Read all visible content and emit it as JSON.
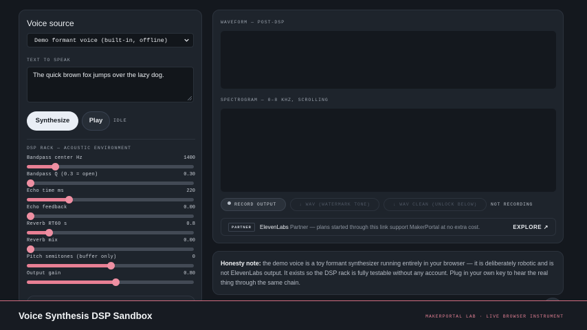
{
  "voice_source": {
    "title": "Voice source",
    "select_value": "Demo formant voice (built-in, offline)",
    "text_label": "TEXT TO SPEAK",
    "text_value": "The quick brown fox jumps over the lazy dog.",
    "synthesize_label": "Synthesize",
    "play_label": "Play",
    "status": "IDLE"
  },
  "dsp_rack": {
    "title": "DSP RACK — ACOUSTIC ENVIRONMENT",
    "sliders": [
      {
        "label": "Bandpass center Hz",
        "value": "1400",
        "fraction": 0.17
      },
      {
        "label": "Bandpass Q (0.3 = open)",
        "value": "0.30",
        "fraction": 0.02
      },
      {
        "label": "Echo time ms",
        "value": "220",
        "fraction": 0.25
      },
      {
        "label": "Echo feedback",
        "value": "0.00",
        "fraction": 0.02
      },
      {
        "label": "Reverb RT60 s",
        "value": "0.8",
        "fraction": 0.13
      },
      {
        "label": "Reverb mix",
        "value": "0.00",
        "fraction": 0.02
      },
      {
        "label": "Pitch semitones (buffer only)",
        "value": "0",
        "fraction": 0.5
      },
      {
        "label": "Output gain",
        "value": "0.80",
        "fraction": 0.53
      }
    ]
  },
  "visuals": {
    "waveform_label": "WAVEFORM — POST-DSP",
    "spectrogram_label": "SPECTROGRAM — 0–8 KHZ, SCROLLING"
  },
  "recording": {
    "record_label": "RECORD OUTPUT",
    "wav_watermark_label": "↓ WAV (WATERMARK TONE)",
    "wav_clean_label": "↓ WAV CLEAN (UNLOCK BELOW)",
    "status": "NOT RECORDING"
  },
  "partner": {
    "badge": "PARTNER",
    "brand": "ElevenLabs",
    "text": " Partner — plans started through this link support MakerPortal at no extra cost.",
    "cta": "EXPLORE ↗"
  },
  "note": {
    "lead": "Honesty note:",
    "body": " the demo voice is a toy formant synthesizer running entirely in your browser — it is deliberately robotic and is not ElevenLabs output. It exists so the DSP rack is fully testable without any account. Plug in your own key to hear the real thing through the same chain."
  },
  "footer": {
    "title": "Voice Synthesis DSP Sandbox",
    "brand": "MAKERPORTAL LAB · LIVE BROWSER INSTRUMENT"
  },
  "colors": {
    "accent": "#e87f94",
    "background": "#14181e",
    "panel": "#1e242c"
  }
}
